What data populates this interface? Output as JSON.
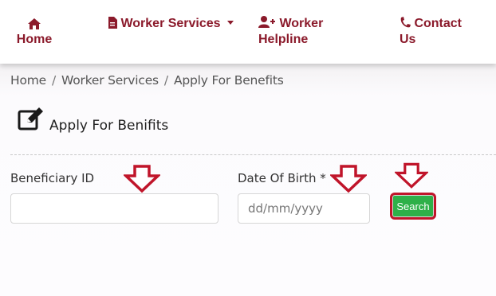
{
  "nav": {
    "home_label": "Home",
    "services_label": "Worker Services",
    "helpline_label_1": "Worker",
    "helpline_label_2": "Helpline",
    "contact_label_1": "Contact",
    "contact_label_2": "Us"
  },
  "breadcrumb": {
    "home": "Home",
    "sep1": "/",
    "services": "Worker Services",
    "sep2": "/",
    "current": "Apply For Benefits"
  },
  "page": {
    "title": "Apply For Benifits"
  },
  "form": {
    "beneficiary_label": "Beneficiary ID",
    "beneficiary_value": "",
    "dob_label": "Date Of Birth *",
    "dob_placeholder": "dd/mm/yyyy",
    "search_label": "Search"
  },
  "colors": {
    "brand": "#8b1a2b",
    "button": "#2eb049",
    "annotation": "#c0152a"
  },
  "icons": [
    "home-icon",
    "file-icon",
    "user-plus-icon",
    "phone-icon",
    "edit-icon",
    "down-arrow-icon"
  ]
}
